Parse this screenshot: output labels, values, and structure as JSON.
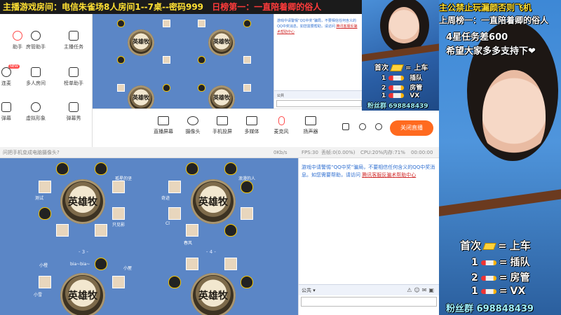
{
  "banner": {
    "room": "主播游戏房间：电信朱雀场8人房间1--7桌--密码999",
    "rank": "日榜第一：一直陪着卿的俗人"
  },
  "left_tools": [
    {
      "label": "助手",
      "icon": "assistant-icon"
    },
    {
      "label": "房管助手",
      "icon": "room-manager-icon"
    },
    {
      "label": "主播任务",
      "icon": "task-icon"
    },
    {
      "label": "连麦",
      "icon": "link-mic-icon",
      "tag": "NEW"
    },
    {
      "label": "多人房间",
      "icon": "multi-room-icon"
    },
    {
      "label": "榜单助手",
      "icon": "rank-icon"
    },
    {
      "label": "弹幕",
      "icon": "danmaku-icon"
    },
    {
      "label": "虚拟形象",
      "icon": "avatar-icon"
    },
    {
      "label": "弹幕秀",
      "icon": "danmaku-show-icon"
    }
  ],
  "toolbar": {
    "items": [
      {
        "label": "直播屏幕",
        "icon": "screen-icon"
      },
      {
        "label": "摄像头",
        "icon": "camera-icon"
      },
      {
        "label": "手机投屏",
        "icon": "phone-cast-icon"
      },
      {
        "label": "多媒体",
        "icon": "media-icon"
      },
      {
        "label": "麦克风",
        "icon": "microphone-icon"
      },
      {
        "label": "扬声器",
        "icon": "speaker-icon"
      }
    ],
    "live_button": "关闭直播"
  },
  "status": {
    "hint": "问把手机变成电脑摄像头?",
    "bitrate": "0Kb/s",
    "fps": "FPS:30",
    "drop": "丢帧:0(0.00%)",
    "cpu": "CPU:20%",
    "mem": "内存:71%",
    "time": "00:00:00"
  },
  "game": {
    "table_logo": "英雄牧",
    "table_numbers": [
      "- 3 -",
      "- 4 -"
    ],
    "players": [
      "测试",
      "孤星的坚",
      "只见影",
      "小屋",
      "bia~bia~",
      "小橙",
      "奇迹",
      "春风",
      "Cl",
      "浪漫的人",
      "小雪"
    ]
  },
  "chat": {
    "message": "游戏中请警惕“QQ中奖”骗局，不要相信任何含义的QQ中奖消息。如您需要帮助，请访问",
    "link": "腾讯客服反骗术帮助中心",
    "channel": "公共",
    "mini_message": "游戏中请警惕“QQ中奖”骗局，不要相信任何含义的QQ中奖消息。如您需要帮助，请访问",
    "mini_link": "腾讯客服反骗术帮助中心"
  },
  "promo_top": {
    "title_row": "首次",
    "title_suffix": "上车",
    "rows": [
      {
        "n": "1",
        "label": "插队"
      },
      {
        "n": "2",
        "label": "房管"
      },
      {
        "n": "1",
        "label": "VX"
      }
    ],
    "fans": "粉丝群 698848439"
  },
  "promo_right": {
    "notice1": "主公禁止玩漏颜否则飞机",
    "notice2": "上周榜一：一直陪着卿的俗人",
    "notice3": "4星任务差600",
    "notice4": "希望大家多多支持下❤",
    "title_row": "首次",
    "title_suffix": "上车",
    "rows": [
      {
        "n": "1",
        "label": "插队"
      },
      {
        "n": "2",
        "label": "房管"
      },
      {
        "n": "1",
        "label": "VX"
      }
    ],
    "fans": "粉丝群 698848439"
  }
}
